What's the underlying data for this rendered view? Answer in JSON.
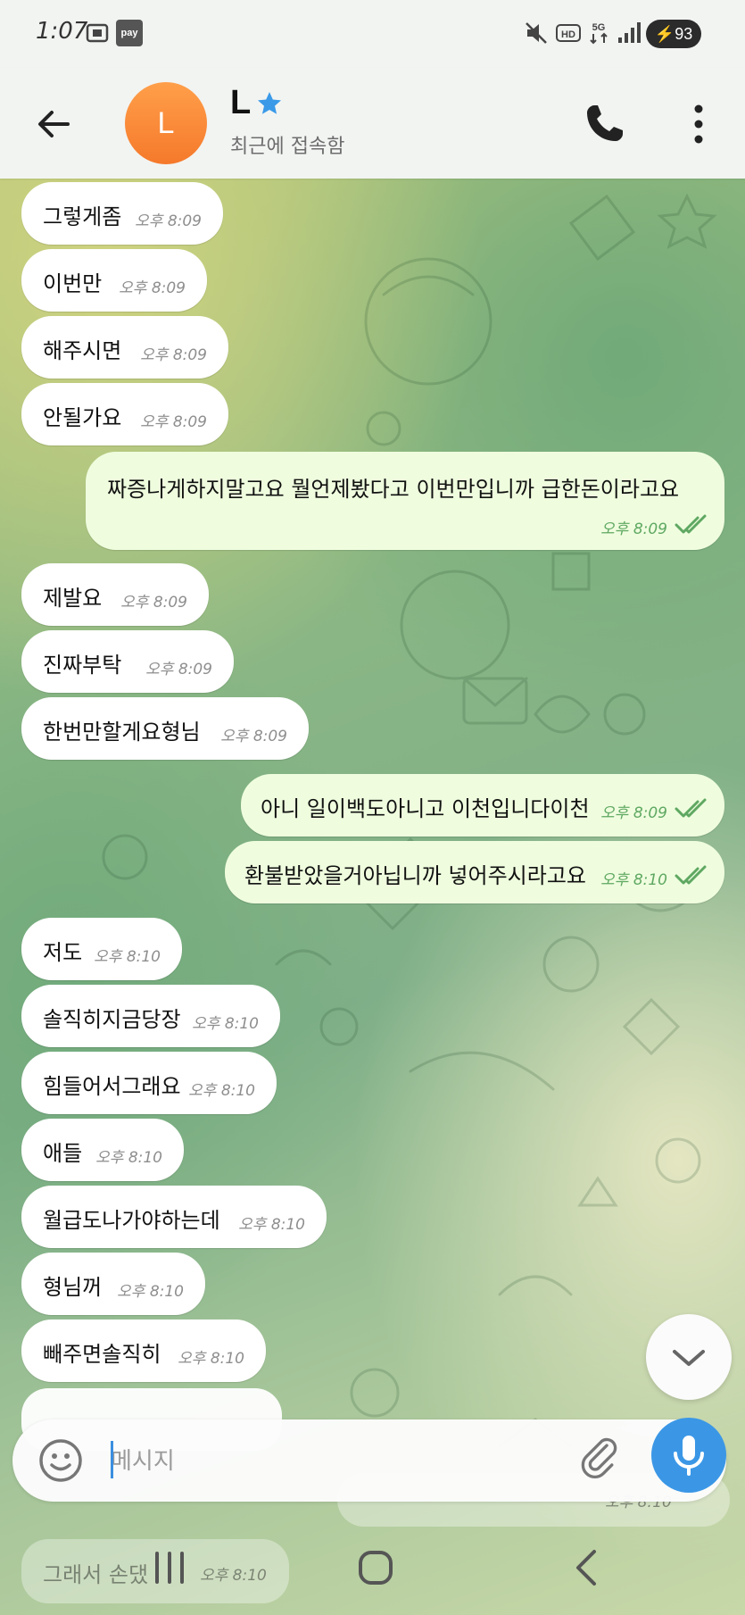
{
  "status_bar": {
    "time": "1:07",
    "pay_label": "pay",
    "battery": "93"
  },
  "header": {
    "avatar_letter": "L",
    "contact_name": "L",
    "status": "최근에 접속함"
  },
  "messages": [
    {
      "dir": "in",
      "text": "그렇게좀",
      "time": "오후 8:09"
    },
    {
      "dir": "in",
      "text": "이번만",
      "time": "오후 8:09"
    },
    {
      "dir": "in",
      "text": "해주시면",
      "time": "오후 8:09"
    },
    {
      "dir": "in",
      "text": "안될가요",
      "time": "오후 8:09"
    },
    {
      "dir": "out",
      "text": "짜증나게하지말고요 뭘언제봤다고 이번만입니까 급한돈이라고요",
      "time": "오후 8:09"
    },
    {
      "dir": "in",
      "text": "제발요",
      "time": "오후 8:09"
    },
    {
      "dir": "in",
      "text": "진짜부탁",
      "time": "오후 8:09"
    },
    {
      "dir": "in",
      "text": "한번만할게요형님",
      "time": "오후 8:09"
    },
    {
      "dir": "out",
      "text": "아니 일이백도아니고 이천입니다이천",
      "time": "오후 8:09"
    },
    {
      "dir": "out",
      "text": "환불받았을거아닙니까 넣어주시라고요",
      "time": "오후 8:10"
    },
    {
      "dir": "in",
      "text": "저도",
      "time": "오후 8:10"
    },
    {
      "dir": "in",
      "text": "솔직히지금당장",
      "time": "오후 8:10"
    },
    {
      "dir": "in",
      "text": "힘들어서그래요",
      "time": "오후 8:10"
    },
    {
      "dir": "in",
      "text": "애들",
      "time": "오후 8:10"
    },
    {
      "dir": "in",
      "text": "월급도나가야하는데",
      "time": "오후 8:10"
    },
    {
      "dir": "in",
      "text": "형님꺼",
      "time": "오후 8:10"
    },
    {
      "dir": "in",
      "text": "빼주면솔직히",
      "time": "오후 8:10"
    }
  ],
  "partial_below": {
    "text": "그래서 손댔",
    "time": "오후 8:10",
    "out_time": "오후 8:10"
  },
  "input": {
    "placeholder": "메시지"
  }
}
